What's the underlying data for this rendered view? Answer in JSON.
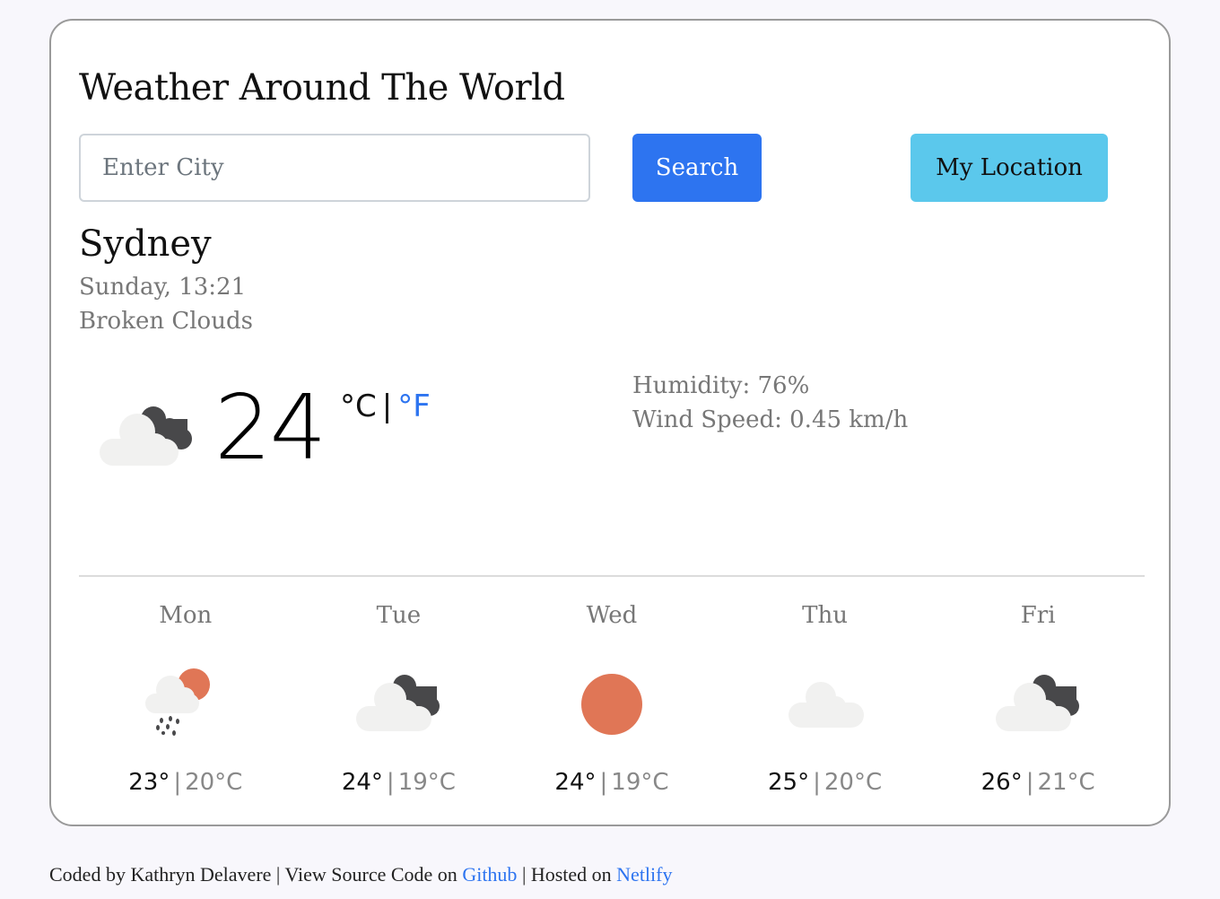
{
  "header": {
    "title": "Weather Around The World"
  },
  "search": {
    "placeholder": "Enter City",
    "value": "",
    "search_label": "Search",
    "location_label": "My Location"
  },
  "current": {
    "city": "Sydney",
    "datetime": "Sunday, 13:21",
    "description": "Broken Clouds",
    "icon": "broken-clouds-icon",
    "temperature": "24",
    "unit_celsius": "°C",
    "unit_separator": "|",
    "unit_fahrenheit": "°F",
    "humidity": "Humidity: 76%",
    "wind": "Wind Speed: 0.45 km/h"
  },
  "forecast": [
    {
      "day": "Mon",
      "icon": "rain-sun-icon",
      "max": "23°",
      "min": "20°C"
    },
    {
      "day": "Tue",
      "icon": "broken-clouds-icon",
      "max": "24°",
      "min": "19°C"
    },
    {
      "day": "Wed",
      "icon": "sun-icon",
      "max": "24°",
      "min": "19°C"
    },
    {
      "day": "Thu",
      "icon": "cloud-icon",
      "max": "25°",
      "min": "20°C"
    },
    {
      "day": "Fri",
      "icon": "broken-clouds-icon",
      "max": "26°",
      "min": "21°C"
    }
  ],
  "footer": {
    "coded_by": "Coded by Kathryn Delavere",
    "sep": "|",
    "source_text": "View Source Code on",
    "github_link": "Github",
    "hosted_text": "Hosted on",
    "netlify_link": "Netlify"
  },
  "colors": {
    "primary": "#2d74f0",
    "info": "#5bc8ec",
    "sun": "#e07656",
    "cloud_light": "#f1f1f0",
    "cloud_dark": "#48484a"
  }
}
